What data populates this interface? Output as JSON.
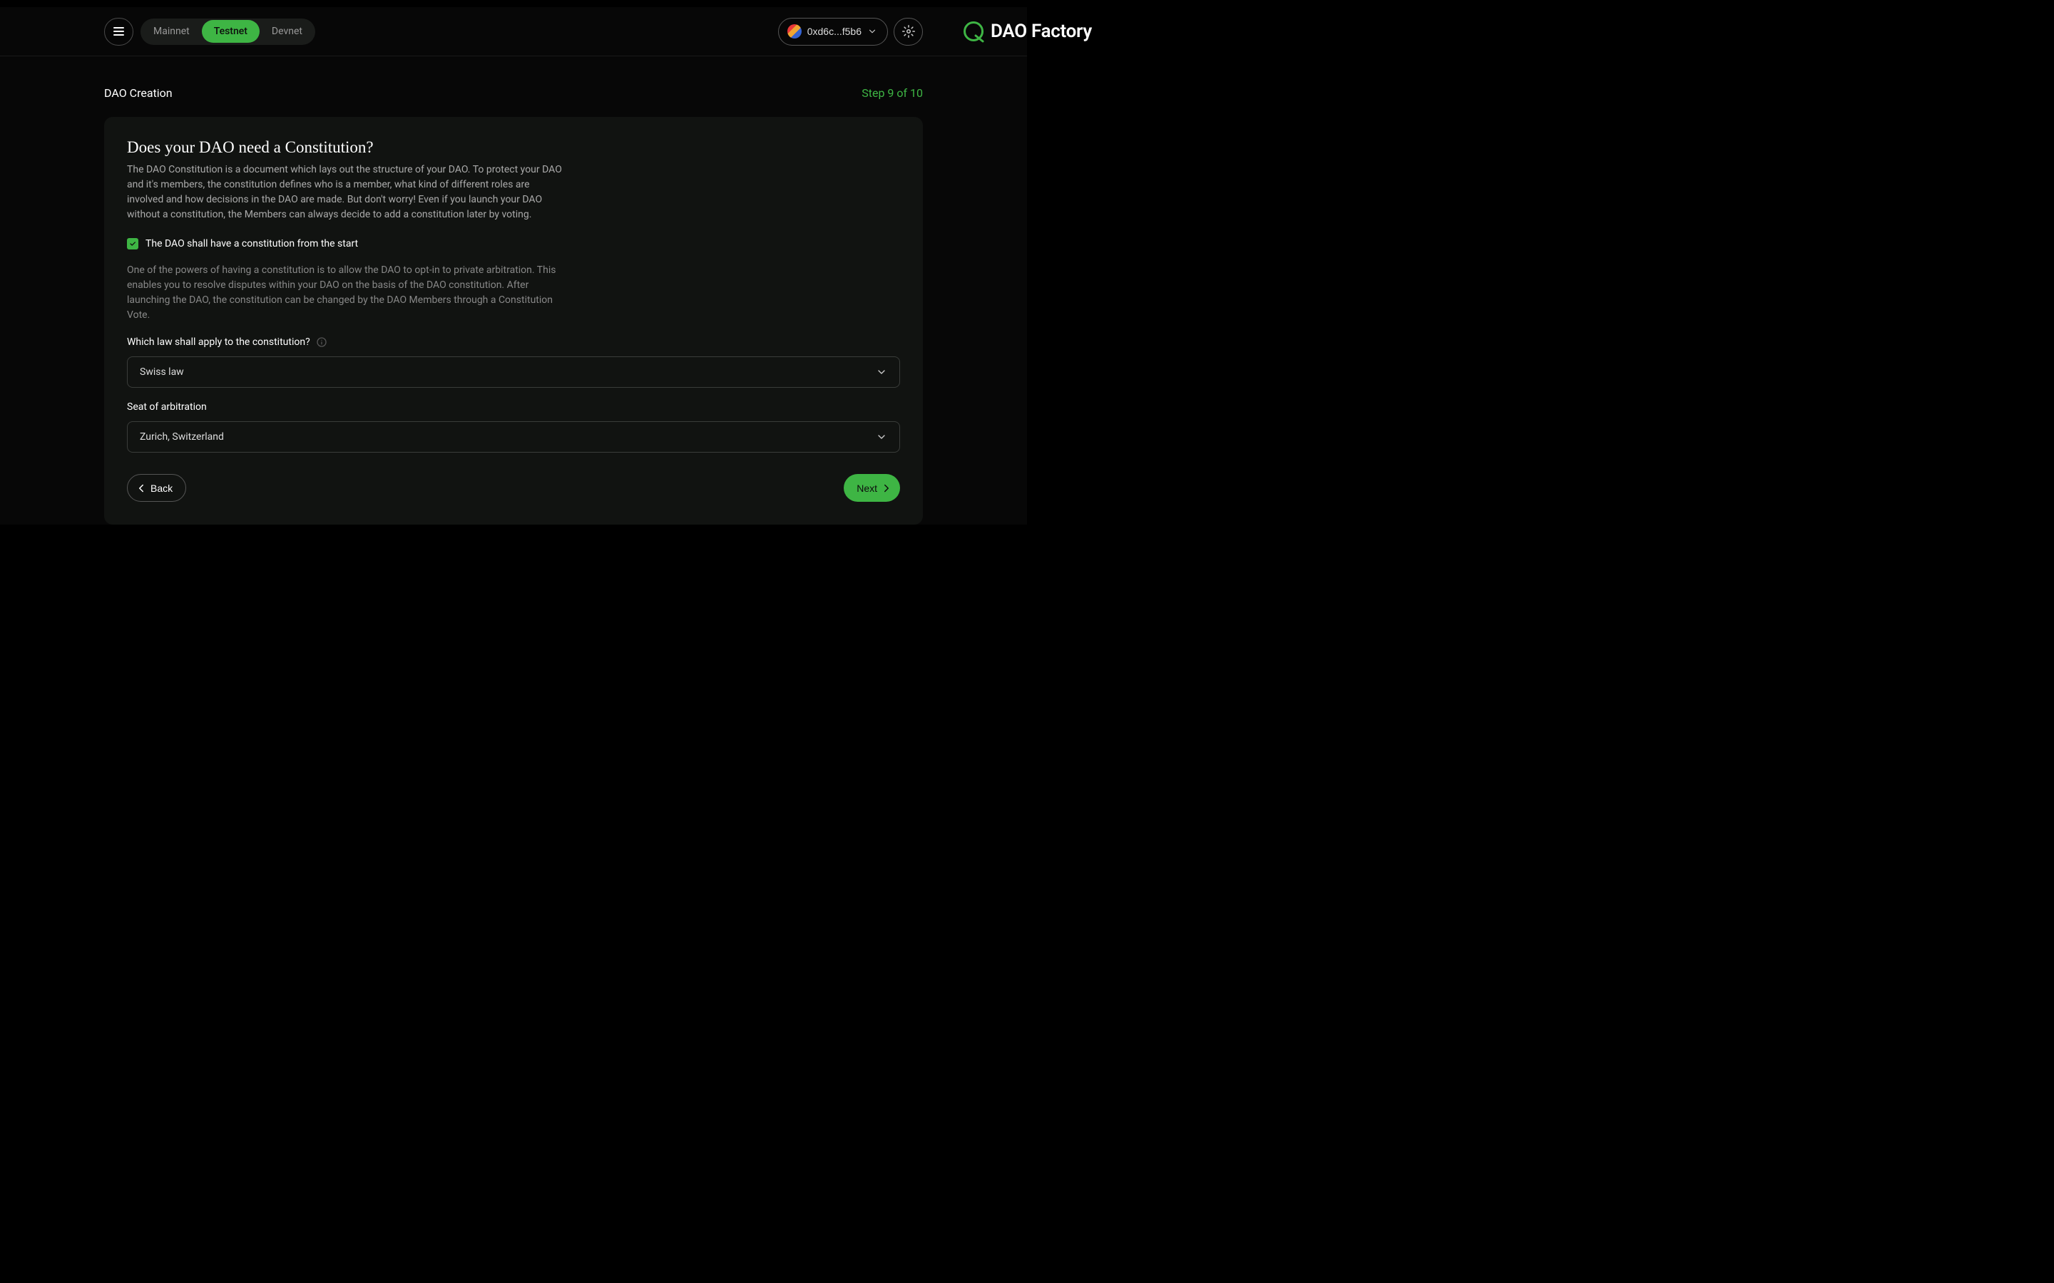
{
  "header": {
    "networks": [
      "Mainnet",
      "Testnet",
      "Devnet"
    ],
    "active_network_index": 1,
    "logo_text": "DAO Factory",
    "wallet_address": "0xd6c...f5b6"
  },
  "page": {
    "title": "DAO Creation",
    "step_label": "Step 9 of 10"
  },
  "card": {
    "heading": "Does your DAO need a Constitution?",
    "intro": "The DAO Constitution is a document which lays out the structure of your DAO. To protect your DAO and it's members, the constitution defines who is a member, what kind of different roles are involved and how decisions in the DAO are made. But don't worry! Even if you launch your DAO without a constitution, the Members can always decide to add a constitution later by voting.",
    "checkbox_label": "The DAO shall have a constitution from the start",
    "info": "One of the powers of having a constitution is to allow the DAO to opt-in to private arbitration. This enables you to resolve disputes within your DAO on the basis of the DAO constitution. After launching the DAO, the constitution can be changed by the DAO Members through a Constitution Vote.",
    "law_label": "Which law shall apply to the constitution?",
    "law_value": "Swiss law",
    "arbitration_label": "Seat of arbitration",
    "arbitration_value": "Zurich, Switzerland",
    "back_label": "Back",
    "next_label": "Next"
  }
}
